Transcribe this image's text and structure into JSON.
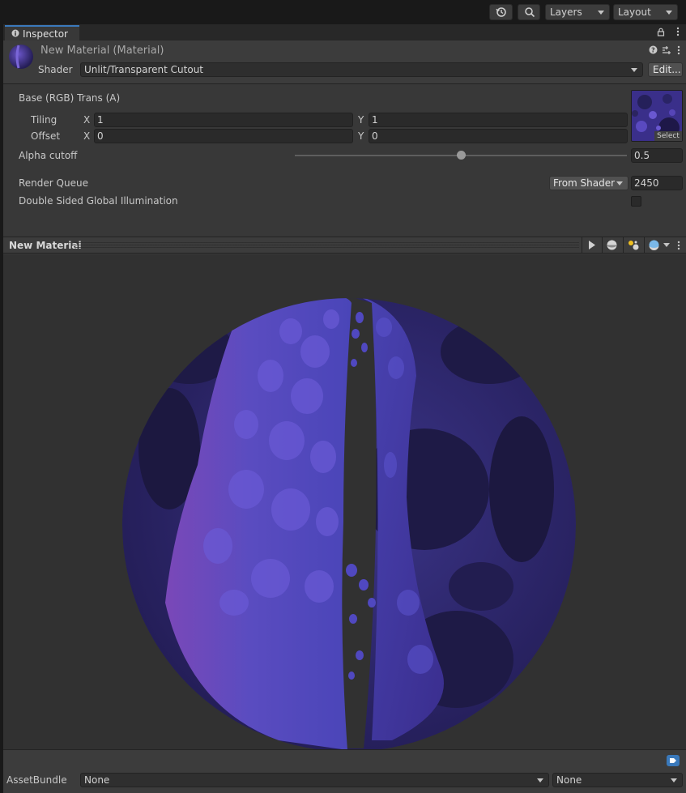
{
  "toolbar": {
    "history_icon": "history-icon",
    "search_icon": "search-icon",
    "layers_label": "Layers",
    "layout_label": "Layout"
  },
  "inspector": {
    "tab_label": "Inspector",
    "material_title": "New Material (Material)",
    "shader_label": "Shader",
    "shader_value": "Unlit/Transparent Cutout",
    "edit_button": "Edit...",
    "texture": {
      "label": "Base (RGB) Trans (A)",
      "tiling_label": "Tiling",
      "offset_label": "Offset",
      "x_label": "X",
      "y_label": "Y",
      "tiling_x": "1",
      "tiling_y": "1",
      "offset_x": "0",
      "offset_y": "0",
      "select_label": "Select"
    },
    "alpha_cutoff": {
      "label": "Alpha cutoff",
      "value": "0.5",
      "slider_fraction": 0.5
    },
    "render_queue": {
      "label": "Render Queue",
      "mode": "From Shader",
      "value": "2450"
    },
    "double_sided_gi": {
      "label": "Double Sided Global Illumination",
      "checked": false
    }
  },
  "preview": {
    "title": "New Material"
  },
  "asset_bundle": {
    "label": "AssetBundle",
    "name_value": "None",
    "variant_value": "None"
  },
  "colors": {
    "accent": "#3a79bb",
    "panel": "#383838",
    "preview_bg": "#313131",
    "material_purple": "#4a3c96"
  }
}
